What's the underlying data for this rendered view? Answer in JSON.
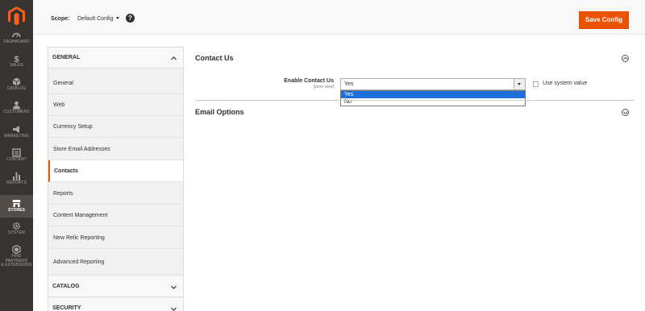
{
  "nav": {
    "items": [
      {
        "label": "DASHBOARD",
        "icon": "dashboard-icon"
      },
      {
        "label": "SALES",
        "icon": "dollar-icon"
      },
      {
        "label": "CATALOG",
        "icon": "cube-icon"
      },
      {
        "label": "CUSTOMERS",
        "icon": "customers-icon"
      },
      {
        "label": "MARKETING",
        "icon": "megaphone-icon"
      },
      {
        "label": "CONTENT",
        "icon": "content-icon"
      },
      {
        "label": "REPORTS",
        "icon": "bar-chart-icon"
      },
      {
        "label": "STORES",
        "icon": "store-icon"
      },
      {
        "label": "SYSTEM",
        "icon": "gear-icon"
      },
      {
        "label_line1": "FIND PARTNERS",
        "label_line2": "& EXTENSIONS",
        "icon": "extensions-icon"
      }
    ],
    "active": "STORES"
  },
  "header": {
    "scope_label": "Scope:",
    "scope_value": "Default Config",
    "help_icon": "?",
    "save_label": "Save Config"
  },
  "sidetabs": {
    "general_title": "GENERAL",
    "items": [
      "General",
      "Web",
      "Currency Setup",
      "Store Email Addresses",
      "Contacts",
      "Reports",
      "Content Management",
      "New Relic Reporting",
      "Advanced Reporting"
    ],
    "active": "Contacts",
    "catalog_title": "CATALOG",
    "security_title": "SECURITY"
  },
  "main": {
    "contact_us_title": "Contact Us",
    "enable_label": "Enable Contact Us",
    "enable_scope": "[store view]",
    "enable_value": "Yes",
    "enable_options": [
      "Yes",
      "No"
    ],
    "use_system_value": "Use system value",
    "email_options_title": "Email Options"
  },
  "colors": {
    "accent": "#eb5202",
    "nav_bg": "#373330",
    "selected_option": "#1e6fd9"
  }
}
